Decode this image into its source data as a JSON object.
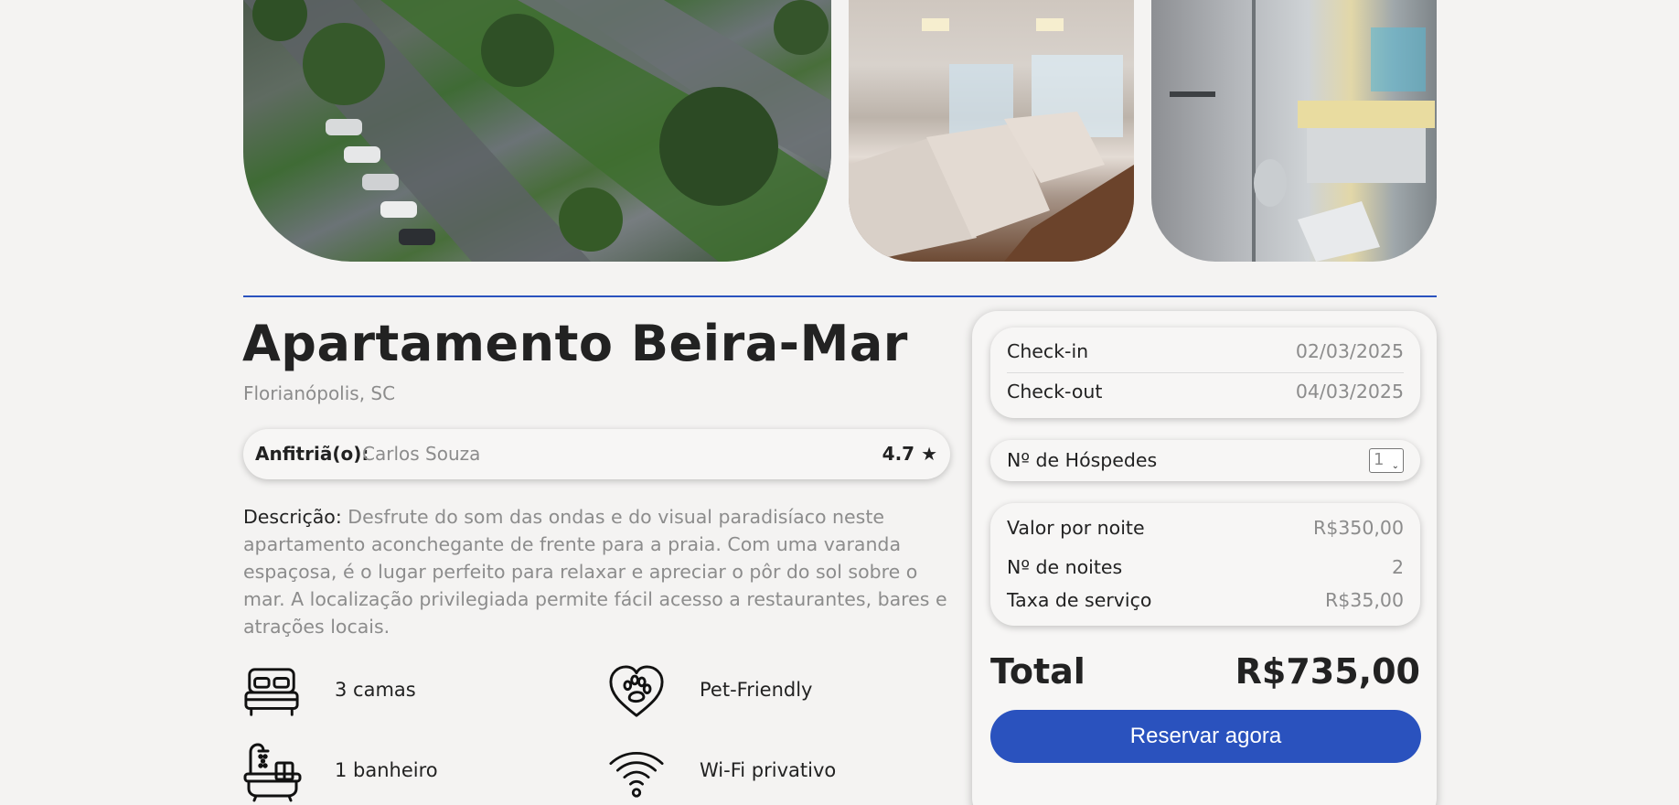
{
  "listing": {
    "title": "Apartamento Beira-Mar",
    "location": "Florianópolis, SC",
    "host_label": "Anfitriã(o):",
    "host_name": "Carlos Souza",
    "rating": "4.7 ★",
    "description_label": "Descrição:",
    "description": "Desfrute do som das ondas e do visual paradisíaco neste apartamento aconchegante de frente para a praia. Com uma varanda espaçosa, é o lugar perfeito para relaxar e apreciar o pôr do sol sobre o mar. A localização privilegiada permite fácil acesso a restaurantes, bares e atrações locais."
  },
  "amenities": [
    {
      "icon": "bed-icon",
      "label": "3 camas"
    },
    {
      "icon": "pet-friendly-icon",
      "label": "Pet-Friendly"
    },
    {
      "icon": "bathtub-icon",
      "label": "1 banheiro"
    },
    {
      "icon": "wifi-icon",
      "label": "Wi-Fi privativo"
    }
  ],
  "booking": {
    "checkin_label": "Check-in",
    "checkin_value": "02/03/2025",
    "checkout_label": "Check-out",
    "checkout_value": "04/03/2025",
    "guests_label": "Nº de Hóspedes",
    "guests_value": "1",
    "nightly_label": "Valor por noite",
    "nightly_value": "R$350,00",
    "nights_label": "Nº de noites",
    "nights_value": "2",
    "fee_label": "Taxa de serviço",
    "fee_value": "R$35,00",
    "total_label": "Total",
    "total_value": "R$735,00",
    "reserve_label": "Reservar agora"
  },
  "colors": {
    "accent": "#2a52be",
    "background": "#f4f3f2",
    "muted_text": "#8c8c8c"
  }
}
